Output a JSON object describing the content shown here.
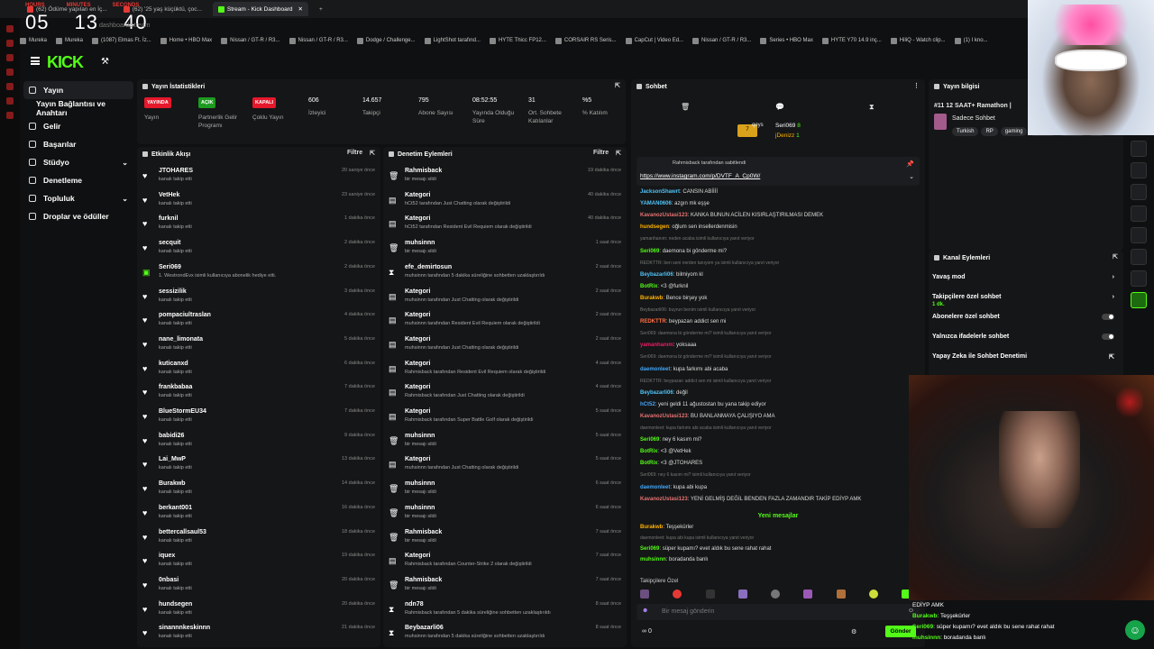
{
  "timer": {
    "labels": [
      "HOURS",
      "MINUTES",
      "SECONDS"
    ],
    "hours": "05",
    "minutes": "13",
    "seconds": "40"
  },
  "browser": {
    "tabs": [
      {
        "label": "(62) Ödüme yapılan en İç..."
      },
      {
        "label": "(62) '25 yaş küçüktü, çoc..."
      },
      {
        "label": "Stream - Kick Dashboard"
      }
    ],
    "address": "dashboard/stream",
    "bookmarks": [
      "Mureka",
      "Mureka",
      "(1087) Elmas Ft. İz...",
      "Home • HBO Max",
      "Nissan / GT-R / R3...",
      "Nissan / GT-R / R3...",
      "Dodge / Challenge...",
      "LightShot tarafınd...",
      "HYTE Thicc FP12...",
      "CORSAIR RS Seris...",
      "CapCut | Video Ed...",
      "Nissan / GT-R / R3...",
      "Series • HBO Max",
      "HYTE Y70 14.9 inç...",
      "HiliQ - Watch clip...",
      "(1) I kno..."
    ]
  },
  "nav": {
    "items": [
      {
        "label": "Yayın"
      },
      {
        "label": "Yayın Bağlantısı ve Anahtarı"
      },
      {
        "label": "Gelir"
      },
      {
        "label": "Başarılar"
      },
      {
        "label": "Stüdyo"
      },
      {
        "label": "Denetleme"
      },
      {
        "label": "Topluluk"
      },
      {
        "label": "Droplar ve ödüller"
      }
    ]
  },
  "stats": {
    "title": "Yayın İstatistikleri",
    "items": [
      {
        "value": "YAYINDA",
        "label": "Yayın",
        "color": "#e5182c"
      },
      {
        "value": "AÇIK",
        "label": "Partnerlik Gelir Programı",
        "color": "#1d9b20"
      },
      {
        "value": "KAPALI",
        "label": "Çoklu Yayın",
        "color": "#e5182c"
      },
      {
        "value": "606",
        "label": "İzleyici"
      },
      {
        "value": "14.657",
        "label": "Takipçi"
      },
      {
        "value": "795",
        "label": "Abone Sayısı"
      },
      {
        "value": "08:52:55",
        "label": "Yayında Olduğu Süre"
      },
      {
        "value": "31",
        "label": "Ort. Sohbete Katılanlar"
      },
      {
        "value": "%5",
        "label": "% Katılım"
      }
    ]
  },
  "activity": {
    "title": "Etkinlik Akışı",
    "filter": "Filtre",
    "rows": [
      {
        "name": "JTOHARES",
        "sub": "kanalı takip etti",
        "time": "20 saniye önce"
      },
      {
        "name": "VetHek",
        "sub": "kanalı takip etti",
        "time": "23 saniye önce"
      },
      {
        "name": "furknil",
        "sub": "kanalı takip etti",
        "time": "1 dakika önce"
      },
      {
        "name": "secquit",
        "sub": "kanalı takip etti",
        "time": "2 dakika önce"
      },
      {
        "name": "Seri069",
        "sub": "1. WestrondEvx isimli kullanıcıya abonelik hediye etti.",
        "time": "2 dakika önce"
      },
      {
        "name": "sessizilik",
        "sub": "kanalı takip etti",
        "time": "3 dakika önce"
      },
      {
        "name": "pompaciultraslan",
        "sub": "kanalı takip etti",
        "time": "4 dakika önce"
      },
      {
        "name": "nane_limonata",
        "sub": "kanalı takip etti",
        "time": "5 dakika önce"
      },
      {
        "name": "kuticanxd",
        "sub": "kanalı takip etti",
        "time": "6 dakika önce"
      },
      {
        "name": "frankbabaa",
        "sub": "kanalı takip etti",
        "time": "7 dakika önce"
      },
      {
        "name": "BlueStormEU34",
        "sub": "kanalı takip etti",
        "time": "7 dakika önce"
      },
      {
        "name": "babidi26",
        "sub": "kanalı takip etti",
        "time": "9 dakika önce"
      },
      {
        "name": "Lai_MwP",
        "sub": "kanalı takip etti",
        "time": "13 dakika önce"
      },
      {
        "name": "Burakwb",
        "sub": "kanalı takip etti",
        "time": "14 dakika önce"
      },
      {
        "name": "berkant001",
        "sub": "kanalı takip etti",
        "time": "16 dakika önce"
      },
      {
        "name": "bettercallsaul53",
        "sub": "kanalı takip etti",
        "time": "18 dakika önce"
      },
      {
        "name": "iquex",
        "sub": "kanalı takip etti",
        "time": "19 dakika önce"
      },
      {
        "name": "0nbasi",
        "sub": "kanalı takip etti",
        "time": "20 dakika önce"
      },
      {
        "name": "hundsegen",
        "sub": "kanalı takip etti",
        "time": "20 dakika önce"
      },
      {
        "name": "sinannnkeskinnn",
        "sub": "kanalı takip etti",
        "time": "21 dakika önce"
      }
    ]
  },
  "moderation": {
    "title": "Denetim Eylemleri",
    "filter": "Filtre",
    "rows": [
      {
        "name": "Rahmisback",
        "sub": "bir mesajı sildi",
        "time": "19 dakika önce"
      },
      {
        "name": "Kategori",
        "sub": "hCt52 tarafından Just Chatting olarak değiştirildi",
        "time": "40 dakika önce"
      },
      {
        "name": "Kategori",
        "sub": "hCt52 tarafından Resident Evil Requiem olarak değiştirildi",
        "time": "40 dakika önce"
      },
      {
        "name": "muhsinnn",
        "sub": "bir mesajı sildi",
        "time": "1 saat önce"
      },
      {
        "name": "efe_demirtosun",
        "sub": "muhsinnn tarafından 5 dakika süreliğine sohbetten uzaklaştırıldı",
        "time": "2 saat önce"
      },
      {
        "name": "Kategori",
        "sub": "muhsinnn tarafından Just Chatting olarak değiştirildi",
        "time": "2 saat önce"
      },
      {
        "name": "Kategori",
        "sub": "muhsinnn tarafından Resident Evil Requiem olarak değiştirildi",
        "time": "2 saat önce"
      },
      {
        "name": "Kategori",
        "sub": "muhsinnn tarafından Just Chatting olarak değiştirildi",
        "time": "2 saat önce"
      },
      {
        "name": "Kategori",
        "sub": "Rahmisback tarafından Resident Evil Requiem olarak değiştirildi",
        "time": "4 saat önce"
      },
      {
        "name": "Kategori",
        "sub": "Rahmisback tarafından Just Chatting olarak değiştirildi",
        "time": "4 saat önce"
      },
      {
        "name": "Kategori",
        "sub": "Rahmisback tarafından Super Battle Golf olarak değiştirildi",
        "time": "5 saat önce"
      },
      {
        "name": "muhsinnn",
        "sub": "bir mesajı sildi",
        "time": "5 saat önce"
      },
      {
        "name": "Kategori",
        "sub": "muhsinnn tarafından Just Chatting olarak değiştirildi",
        "time": "5 saat önce"
      },
      {
        "name": "muhsinnn",
        "sub": "bir mesajı sildi",
        "time": "6 saat önce"
      },
      {
        "name": "muhsinnn",
        "sub": "bir mesajı sildi",
        "time": "6 saat önce"
      },
      {
        "name": "Rahmisback",
        "sub": "bir mesajı sildi",
        "time": "7 saat önce"
      },
      {
        "name": "Kategori",
        "sub": "Rahmisback tarafından Counter-Strike 2 olarak değiştirildi",
        "time": "7 saat önce"
      },
      {
        "name": "Rahmisback",
        "sub": "bir mesajı sildi",
        "time": "7 saat önce"
      },
      {
        "name": "ndn78",
        "sub": "Rahmisback tarafından 5 dakika süreliğine sohbetten uzaklaştırıldı",
        "time": "8 saat önce"
      },
      {
        "name": "Beybazarli06",
        "sub": "muhsinnn tarafından 5 dakika süreliğine sohbetten uzaklaştırıldı",
        "time": "8 saat önce"
      }
    ]
  },
  "chat": {
    "title": "Sohbet",
    "leaders": [
      {
        "name": "Seri069",
        "count": "8"
      },
      {
        "name": "jDenizz",
        "count": "1"
      }
    ],
    "leader_left": "qeys",
    "leader_left_count": "7",
    "pinned_by": "Rahmisback tarafından sabitlendi",
    "pinned_link": "https://www.instagram.com/p/DVTF_A_Cp0W/",
    "messages": [
      {
        "user": "JacksonShawrt",
        "text": "CANSIN ABİİİİ",
        "color": "#4fc3f7",
        "reply": false
      },
      {
        "user": "YAMAN0606",
        "text": "azgın mk eşşe",
        "color": "#4fc3f7",
        "reply": false
      },
      {
        "user": "KavanozUstasi123",
        "text": "KANKA BUNUN ACİLEN KISIRLAŞTIRILMASI DEMEK",
        "color": "#e57373",
        "reply": false
      },
      {
        "user": "hundsegen",
        "text": "oğlum sen insellerdenmisin",
        "color": "#ffb300",
        "reply": false
      },
      {
        "user": "",
        "text": "yamanhanım: neden acaba isimli kullanıcıya yanıt veriyor",
        "color": "#777",
        "reply": true
      },
      {
        "user": "Seri069",
        "text": "daemona bi gönderme mi?",
        "color": "#53fc18",
        "reply": false
      },
      {
        "user": "",
        "text": "REDKTTR: ben seni nerden tanıyom ya isimli kullanıcıya yanıt veriyor",
        "color": "#777",
        "reply": true
      },
      {
        "user": "Beybazarli06",
        "text": "bilmiyom kl",
        "color": "#4fc3f7",
        "reply": false
      },
      {
        "user": "BotRix",
        "text": "<3 @furknil",
        "color": "#53fc18",
        "reply": false
      },
      {
        "user": "Burakwb",
        "text": "Bence birşey yok",
        "color": "#ffb300",
        "reply": false
      },
      {
        "user": "",
        "text": "Beybazarli06: buyrun benim isimli kullanıcıya yanıt veriyor",
        "color": "#777",
        "reply": true
      },
      {
        "user": "REDKTTR",
        "text": "beypazarı addict sen mi",
        "color": "#ff7043",
        "reply": false
      },
      {
        "user": "",
        "text": "Seri069: daemona bi gönderme mi? isimli kullanıcıya yanıt veriyor",
        "color": "#777",
        "reply": true
      },
      {
        "user": "yamanhanım",
        "text": "yoksaaa",
        "color": "#e91e63",
        "reply": false
      },
      {
        "user": "",
        "text": "Seri069: daemona bi gönderme mi? isimli kullanıcıya yanıt veriyor",
        "color": "#777",
        "reply": true
      },
      {
        "user": "daemonleet",
        "text": "kupa farkımı abi acaba",
        "color": "#42a5f5",
        "reply": false
      },
      {
        "user": "",
        "text": "REDKTTR: beypazarı addict sen mi isimli kullanıcıya yanıt veriyor",
        "color": "#777",
        "reply": true
      },
      {
        "user": "Beybazarli06",
        "text": "değil",
        "color": "#4fc3f7",
        "reply": false
      },
      {
        "user": "hCt52",
        "text": "yeni geldi 11 ağustostan bu yana takip ediyor",
        "color": "#42a5f5",
        "reply": false
      },
      {
        "user": "KavanozUstasi123",
        "text": "BU BANLANMAYA ÇALIŞIYO AMA",
        "color": "#e57373",
        "reply": false
      },
      {
        "user": "",
        "text": "daemonleet: kupa farkımı abi acaba isimli kullanıcıya yanıt veriyor",
        "color": "#777",
        "reply": true
      },
      {
        "user": "Seri069",
        "text": "ney 6 kasım mi?",
        "color": "#53fc18",
        "reply": false
      },
      {
        "user": "BotRix",
        "text": "<3 @VetHek",
        "color": "#53fc18",
        "reply": false
      },
      {
        "user": "BotRix",
        "text": "<3 @JTOHARES",
        "color": "#53fc18",
        "reply": false
      },
      {
        "user": "",
        "text": "Seri069: ney 6 kasım mi? isimli kullanıcıya yanıt veriyor",
        "color": "#777",
        "reply": true
      },
      {
        "user": "daemonleet",
        "text": "kupa abi kupa",
        "color": "#42a5f5",
        "reply": false
      },
      {
        "user": "KavanozUstasi123",
        "text": "YENİ GELMİŞ DEĞİL BENDEN FAZLA ZAMANDIR TAKİP EDİYP AMK",
        "color": "#e57373",
        "reply": false
      }
    ],
    "new_messages": "Yeni mesajlar",
    "after": [
      {
        "user": "Burakwb",
        "text": "Teşşekürler",
        "color": "#ffb300",
        "reply": false
      },
      {
        "user": "",
        "text": "daemonleet: kupa abi kupa isimli kullanıcıya yanıt veriyor",
        "color": "#777",
        "reply": true
      },
      {
        "user": "Seri069",
        "text": "süper kupamı? evet aldık bu sene rahat rahat",
        "color": "#53fc18",
        "reply": false
      },
      {
        "user": "muhsinnn",
        "text": "boradanda banlı",
        "color": "#53fc18",
        "reply": false
      }
    ],
    "followers_only": "Takipçilere Özel",
    "input_placeholder": "Bir mesaj gönderin",
    "points": "0",
    "send": "Gönder"
  },
  "stream_info": {
    "title": "Yayın bilgisi",
    "stream_title": "#11 12 SAAT+ Ramathon |",
    "category": "Sadece Sohbet",
    "tags": [
      "Turkish",
      "RP",
      "gaming",
      "Türkçe",
      "English",
      "Chi"
    ]
  },
  "channel_actions": {
    "title": "Kanal Eylemleri",
    "items": [
      {
        "label": "Yavaş mod",
        "sub": "",
        "kind": "arrow"
      },
      {
        "label": "Takipçilere özel sohbet",
        "sub": "1 dk.",
        "kind": "arrow"
      },
      {
        "label": "Abonelere özel sohbet",
        "sub": "",
        "kind": "toggle"
      },
      {
        "label": "Yalnızca ifadelerle sohbet",
        "sub": "",
        "kind": "toggle"
      },
      {
        "label": "Yapay Zeka ile Sohbet Denetimi",
        "sub": "",
        "kind": "link"
      }
    ]
  },
  "overlay_chat": [
    {
      "user": "",
      "text": "EDİYP AMK"
    },
    {
      "user": "Burakwb",
      "text": "Teşşekürler"
    },
    {
      "user": "Seri069",
      "text": "süper kupamı? evet aldık bu sene rahat rahat"
    },
    {
      "user": "muhsinnn",
      "text": "boradanda banlı"
    }
  ]
}
